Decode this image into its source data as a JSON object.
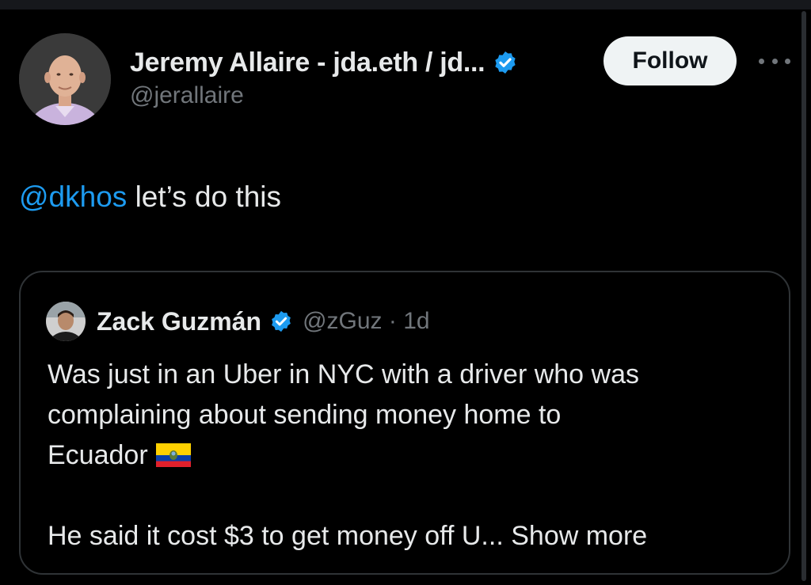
{
  "author": {
    "display_name": "Jeremy Allaire - jda.eth / jd...",
    "handle": "@jerallaire",
    "verified_icon": "verified-badge-icon",
    "verified_color": "#1d9bf0"
  },
  "actions": {
    "follow_label": "Follow",
    "more_icon": "more-options-icon"
  },
  "tweet": {
    "mention": "@dkhos",
    "text": " let’s do this",
    "mention_color": "#1d9bf0"
  },
  "quote": {
    "display_name": "Zack Guzmán",
    "handle_time": "@zGuz · 1d",
    "lines": [
      "Was just in an Uber in NYC with a driver who was",
      "complaining about sending money home to",
      "Ecuador"
    ],
    "flag_icon": "ecuador-flag-icon",
    "truncated_line": "He said it cost $3 to get money off U...",
    "show_more_label": "Show more"
  },
  "colors": {
    "background": "#000000",
    "text_primary": "#e7e9ea",
    "text_secondary": "#71767b",
    "border": "#2f3336",
    "follow_bg": "#eff3f4",
    "accent": "#1d9bf0"
  }
}
